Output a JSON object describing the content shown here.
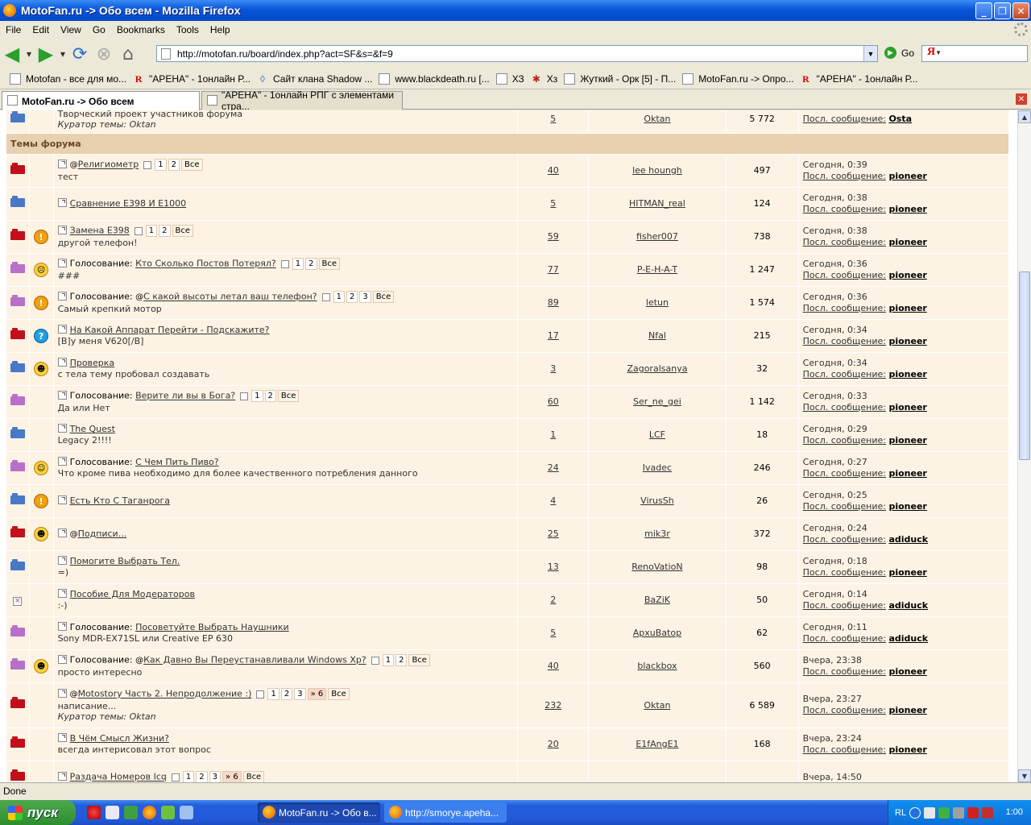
{
  "window": {
    "title": "MotoFan.ru -> Обо всем - Mozilla Firefox"
  },
  "menu": [
    "File",
    "Edit",
    "View",
    "Go",
    "Bookmarks",
    "Tools",
    "Help"
  ],
  "nav": {
    "url": "http://motofan.ru/board/index.php?act=SF&s=&f=9",
    "go_label": "Go",
    "search_logo": "Я"
  },
  "bookmarks": [
    {
      "label": "Motofan - все для мо...",
      "icon": "page"
    },
    {
      "label": "\"АРЕНА\" - 1онлайн Р...",
      "icon": "r"
    },
    {
      "label": "Сайт клана Shadow ...",
      "icon": "shadow"
    },
    {
      "label": "www.blackdeath.ru [...",
      "icon": "page"
    },
    {
      "label": "ХЗ",
      "icon": "page"
    },
    {
      "label": "Хз",
      "icon": "jsd"
    },
    {
      "label": "Жуткий - Орк [5] - П...",
      "icon": "page"
    },
    {
      "label": "MotoFan.ru -> Опро...",
      "icon": "page"
    },
    {
      "label": "\"АРЕНА\" - 1онлайн Р...",
      "icon": "r"
    }
  ],
  "tabs": [
    {
      "label": "MotoFan.ru -> Обо всем",
      "active": true
    },
    {
      "label": "\"АРЕНА\" - 1онлайн РПГ с элементами стра...",
      "active": false
    }
  ],
  "partial_row": {
    "desc": "Творческий проект участников форума",
    "curator": "Куратор темы: Oktan",
    "replies": "5",
    "author": "Oktan",
    "views": "5 772",
    "last_label": "Посл. сообщение:",
    "last_user": "Osta"
  },
  "category": "Темы форума",
  "last_label": "Посл. сообщение:",
  "topics": [
    {
      "folder": "red",
      "emo": "",
      "prefix": "",
      "attach": true,
      "title": "Религиометр",
      "pages": [
        "1",
        "2"
      ],
      "desc": "тест",
      "curator": "",
      "replies": "40",
      "author": "lee houngh",
      "views": "497",
      "date": "Сегодня, 0:39",
      "user": "pioneer"
    },
    {
      "folder": "blue",
      "emo": "",
      "prefix": "",
      "attach": false,
      "title": "Сравнение E398 И E1000",
      "pages": [],
      "desc": "",
      "curator": "",
      "replies": "5",
      "author": "HITMAN_real",
      "views": "124",
      "date": "Сегодня, 0:38",
      "user": "pioneer"
    },
    {
      "folder": "red",
      "emo": "warn",
      "prefix": "",
      "attach": false,
      "title": "Замена E398",
      "pages": [
        "1",
        "2"
      ],
      "desc": "другой телефон!",
      "curator": "",
      "replies": "59",
      "author": "fisher007",
      "views": "738",
      "date": "Сегодня, 0:38",
      "user": "pioneer"
    },
    {
      "folder": "purple",
      "emo": "sad",
      "prefix": "Голосование: ",
      "attach": false,
      "title": "Кто Сколько Постов Потерял?",
      "pages": [
        "1",
        "2"
      ],
      "desc": "###",
      "curator": "",
      "replies": "77",
      "author": "P-E-H-A-T",
      "views": "1 247",
      "date": "Сегодня, 0:36",
      "user": "pioneer"
    },
    {
      "folder": "purple",
      "emo": "warn",
      "prefix": "Голосование: ",
      "attach": true,
      "title": "С какой высоты летал ваш телефон?",
      "pages": [
        "1",
        "2",
        "3"
      ],
      "desc": "Самый крепкий мотор",
      "curator": "",
      "replies": "89",
      "author": "letun",
      "views": "1 574",
      "date": "Сегодня, 0:36",
      "user": "pioneer"
    },
    {
      "folder": "red",
      "emo": "q",
      "prefix": "",
      "attach": false,
      "title": "На Какой Аппарат Перейти - Подскажите?",
      "pages": [],
      "desc": "[B]у меня V620[/B]",
      "curator": "",
      "replies": "17",
      "author": "Nfal",
      "views": "215",
      "date": "Сегодня, 0:34",
      "user": "pioneer"
    },
    {
      "folder": "blue",
      "emo": "cool",
      "prefix": "",
      "attach": false,
      "title": "Проверка",
      "pages": [],
      "desc": "с тела тему пробовал создавать",
      "curator": "",
      "replies": "3",
      "author": "Zagoralsanya",
      "views": "32",
      "date": "Сегодня, 0:34",
      "user": "pioneer"
    },
    {
      "folder": "purple",
      "emo": "",
      "prefix": "Голосование: ",
      "attach": false,
      "title": "Верите ли вы в Бога?",
      "pages": [
        "1",
        "2"
      ],
      "desc": "Да или Нет",
      "curator": "",
      "replies": "60",
      "author": "Ser_ne_gei",
      "views": "1 142",
      "date": "Сегодня, 0:33",
      "user": "pioneer"
    },
    {
      "folder": "blue",
      "emo": "",
      "prefix": "",
      "attach": false,
      "title": "The Quest",
      "pages": [],
      "desc": "Legacy 2!!!!",
      "curator": "",
      "replies": "1",
      "author": "LCF",
      "views": "18",
      "date": "Сегодня, 0:29",
      "user": "pioneer"
    },
    {
      "folder": "purple",
      "emo": "think",
      "prefix": "Голосование: ",
      "attach": false,
      "title": "С Чем Пить Пиво?",
      "pages": [],
      "desc": "Что кроме пива необходимо для более качественного потребления данного",
      "curator": "",
      "replies": "24",
      "author": "Ivadec",
      "views": "246",
      "date": "Сегодня, 0:27",
      "user": "pioneer"
    },
    {
      "folder": "blue",
      "emo": "warn",
      "prefix": "",
      "attach": false,
      "title": "Есть Кто С Таганрога",
      "pages": [],
      "desc": "",
      "curator": "",
      "replies": "4",
      "author": "VirusSh",
      "views": "26",
      "date": "Сегодня, 0:25",
      "user": "pioneer"
    },
    {
      "folder": "red",
      "emo": "cool",
      "prefix": "",
      "attach": true,
      "title": "Подписи...",
      "pages": [],
      "desc": "",
      "curator": "",
      "replies": "25",
      "author": "mik3r",
      "views": "372",
      "date": "Сегодня, 0:24",
      "user": "adiduck"
    },
    {
      "folder": "blue",
      "emo": "",
      "prefix": "",
      "attach": false,
      "title": "Помогите Выбрать Тел.",
      "pages": [],
      "desc": "=)",
      "curator": "",
      "replies": "13",
      "author": "RenoVatioN",
      "views": "98",
      "date": "Сегодня, 0:18",
      "user": "pioneer"
    },
    {
      "folder": "moved",
      "emo": "",
      "prefix": "",
      "attach": false,
      "title": "Пособие Для Модераторов",
      "pages": [],
      "desc": ":-)",
      "curator": "",
      "replies": "2",
      "author": "BaZiK",
      "views": "50",
      "date": "Сегодня, 0:14",
      "user": "adiduck"
    },
    {
      "folder": "purple",
      "emo": "",
      "prefix": "Голосование: ",
      "attach": false,
      "title": "Посоветуйте Выбрать Наушники",
      "pages": [],
      "desc": "Sony MDR-EX71SL или Creative EP 630",
      "curator": "",
      "replies": "5",
      "author": "ApxuBatop",
      "views": "62",
      "date": "Сегодня, 0:11",
      "user": "adiduck"
    },
    {
      "folder": "purple",
      "emo": "cool",
      "prefix": "Голосование: ",
      "attach": true,
      "title": "Как Давно Вы Переустанавливали Windows Xp?",
      "pages": [
        "1",
        "2"
      ],
      "desc": "просто интересно",
      "curator": "",
      "replies": "40",
      "author": "blackbox",
      "views": "560",
      "date": "Вчера, 23:38",
      "user": "pioneer"
    },
    {
      "folder": "red",
      "emo": "",
      "prefix": "",
      "attach": true,
      "title": "Motostory Часть 2. Непродолжение :)",
      "pages": [
        "1",
        "2",
        "3"
      ],
      "jump": "» 6",
      "desc": "написание...",
      "curator": "Куратор темы: Oktan",
      "replies": "232",
      "author": "Oktan",
      "views": "6 589",
      "date": "Вчера, 23:27",
      "user": "pioneer"
    },
    {
      "folder": "red",
      "emo": "",
      "prefix": "",
      "attach": false,
      "title": "В Чём Смысл Жизни?",
      "pages": [],
      "desc": "всегда интерисовал этот вопрос",
      "curator": "",
      "replies": "20",
      "author": "E1fAngE1",
      "views": "168",
      "date": "Вчера, 23:24",
      "user": "pioneer"
    },
    {
      "folder": "red",
      "emo": "",
      "prefix": "",
      "attach": false,
      "title": "Раздача Номеров Icq",
      "pages": [
        "1",
        "2",
        "3"
      ],
      "jump": "» 6",
      "desc": "",
      "curator": "",
      "replies": "",
      "author": "",
      "views": "",
      "date": "Вчера, 14:50",
      "user": ""
    }
  ],
  "pages_all": "Все",
  "status": "Done",
  "taskbar": {
    "start": "пуск",
    "buttons": [
      "MotoFan.ru -> Обо в...",
      "http://smorye.apeha..."
    ],
    "lang": "RL",
    "clock": "1:00"
  }
}
